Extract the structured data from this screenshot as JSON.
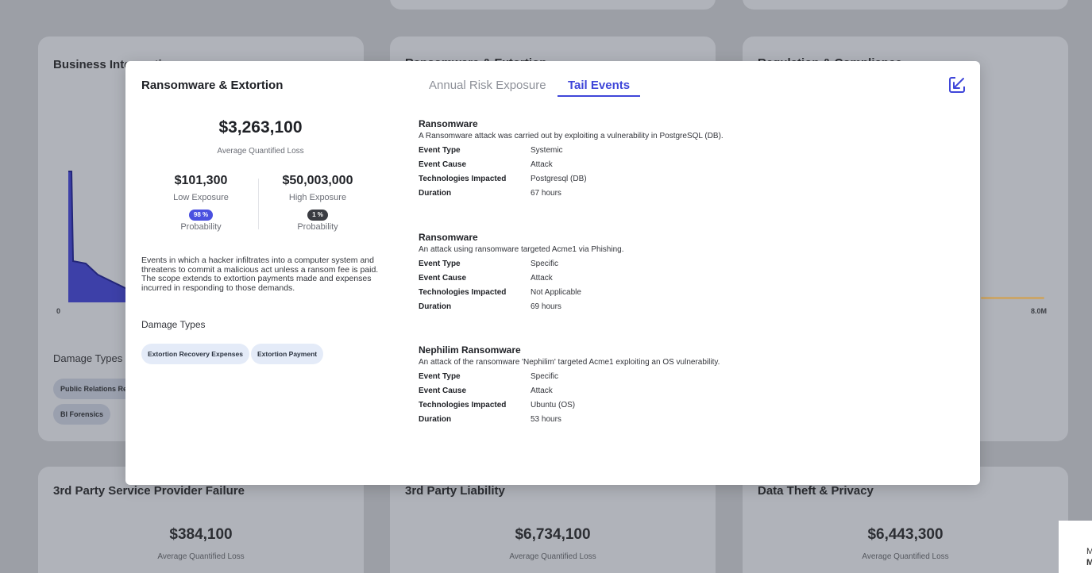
{
  "background": {
    "cards": {
      "business_interruption": {
        "title": "Business Interruption",
        "axis_start": "0",
        "damage_types_heading": "Damage Types",
        "chips": [
          "Public Relations Repair",
          "BI Forensics"
        ]
      },
      "ransomware_extortion": {
        "title": "Ransomware & Extortion"
      },
      "regulation_compliance": {
        "title": "Regulation & Compliance",
        "axis_end": "8.0M"
      },
      "third_party_service": {
        "title": "3rd Party Service Provider Failure",
        "amount": "$384,100",
        "label": "Average Quantified Loss"
      },
      "third_party_liability": {
        "title": "3rd Party Liability",
        "amount": "$6,734,100",
        "label": "Average Quantified Loss"
      },
      "data_theft": {
        "title": "Data Theft & Privacy",
        "amount": "$6,443,300",
        "label": "Average Quantified Loss"
      }
    },
    "corner_text": [
      "M",
      "M"
    ]
  },
  "modal": {
    "title": "Ransomware & Extortion",
    "summary": {
      "amount": "$3,263,100",
      "label": "Average Quantified Loss"
    },
    "low": {
      "amount": "$101,300",
      "label": "Low Exposure",
      "badge": "98 %",
      "prob_label": "Probability",
      "badge_color": "#4a50e0"
    },
    "high": {
      "amount": "$50,003,000",
      "label": "High Exposure",
      "badge": "1 %",
      "prob_label": "Probability",
      "badge_color": "#3a3c42"
    },
    "description": "Events in which a hacker infiltrates into a computer system and threatens to commit a malicious act unless a ransom fee is paid. The scope extends to extortion payments made and expenses incurred in responding to those demands.",
    "damage_types_heading": "Damage Types",
    "damage_types": [
      "Extortion Recovery Expenses",
      "Extortion Payment"
    ],
    "tabs": {
      "annual": "Annual Risk Exposure",
      "tail": "Tail Events"
    },
    "expand_icon": "collapse-arrow-icon",
    "accent_color": "#3f46d9",
    "field_labels": {
      "event_type": "Event Type",
      "event_cause": "Event Cause",
      "technologies": "Technologies Impacted",
      "duration": "Duration"
    },
    "events": [
      {
        "name": "Ransomware",
        "description": "A Ransomware attack was carried out by exploiting a vulnerability in PostgreSQL (DB).",
        "event_type": "Systemic",
        "event_cause": "Attack",
        "technologies": "Postgresql (DB)",
        "duration": "67 hours"
      },
      {
        "name": "Ransomware",
        "description": "An attack using ransomware targeted Acme1 via Phishing.",
        "event_type": "Specific",
        "event_cause": "Attack",
        "technologies": "Not Applicable",
        "duration": "69 hours"
      },
      {
        "name": "Nephilim Ransomware",
        "description": "An attack of the ransomware 'Nephilim' targeted Acme1 exploiting an OS vulnerability.",
        "event_type": "Specific",
        "event_cause": "Attack",
        "technologies": "Ubuntu (OS)",
        "duration": "53 hours"
      }
    ]
  }
}
